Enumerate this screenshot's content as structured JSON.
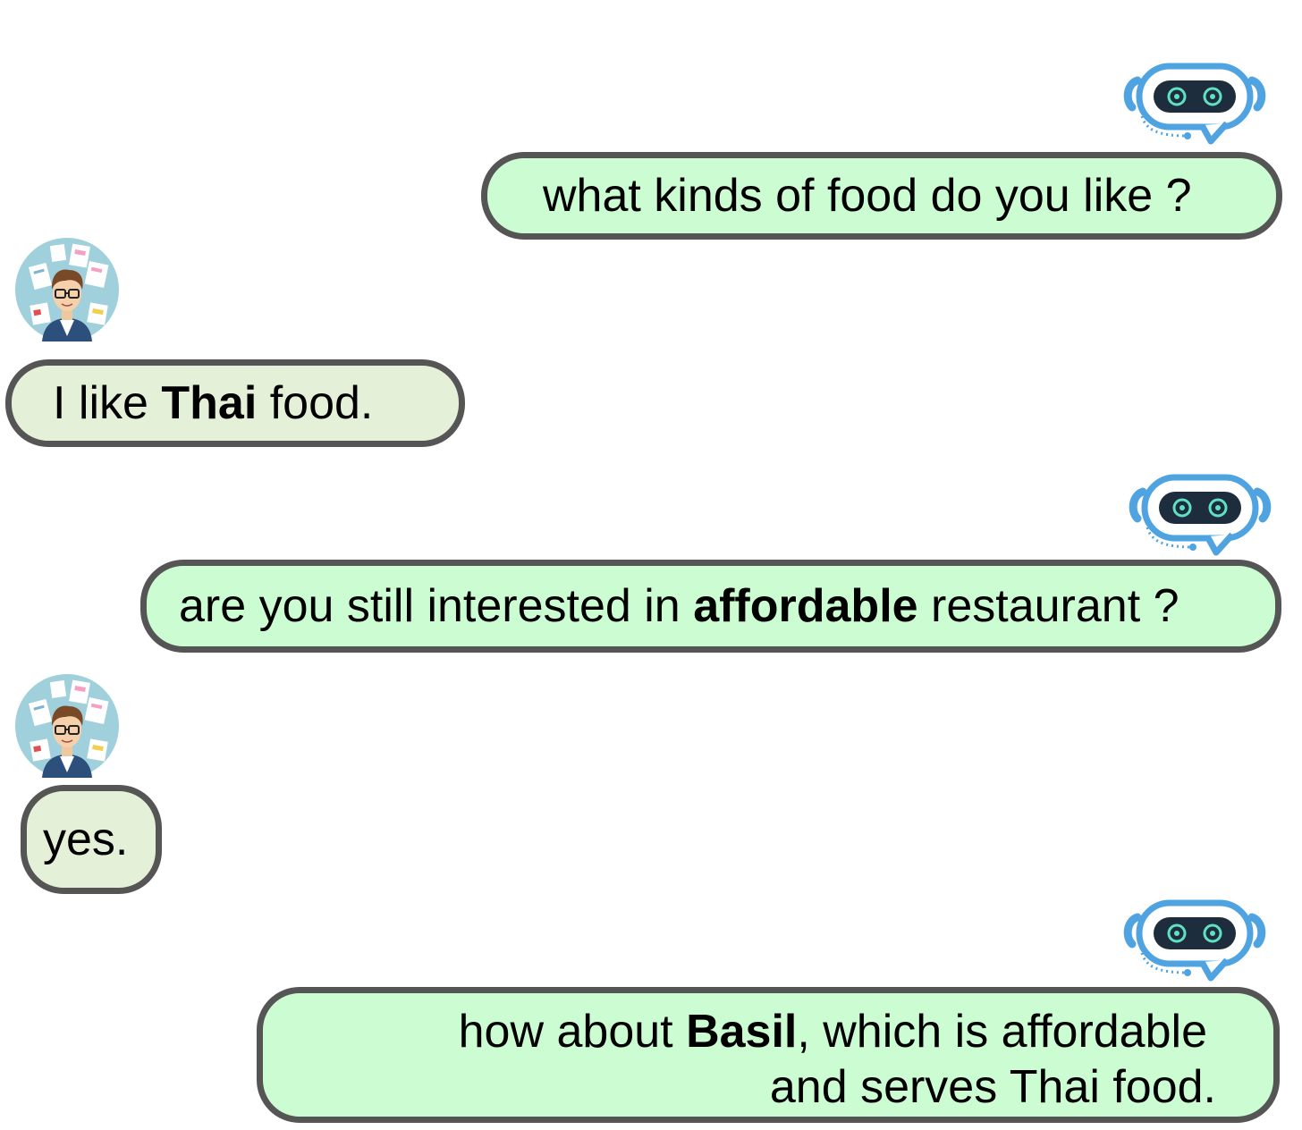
{
  "messages": [
    {
      "speaker": "bot",
      "parts": [
        {
          "t": "what kinds of food do you like ?"
        }
      ]
    },
    {
      "speaker": "user",
      "parts": [
        {
          "t": "I like "
        },
        {
          "t": "Thai",
          "bold": true
        },
        {
          "t": " food."
        }
      ]
    },
    {
      "speaker": "bot",
      "parts": [
        {
          "t": "are you still interested in "
        },
        {
          "t": "affordable",
          "bold": true
        },
        {
          "t": " restaurant ?"
        }
      ]
    },
    {
      "speaker": "user",
      "parts": [
        {
          "t": "yes."
        }
      ]
    },
    {
      "speaker": "bot",
      "parts": [
        {
          "t": "how about "
        },
        {
          "t": "Basil",
          "bold": true
        },
        {
          "t": ", which is affordable"
        },
        {
          "t": "and serves Thai food."
        }
      ]
    }
  ],
  "colors": {
    "bot_bubble": "#ccfdd2",
    "user_bubble": "#e5f0d8",
    "bubble_border": "#555555",
    "robot_accent": "#4fa3e0",
    "robot_visor": "#1e2d3d",
    "robot_eyes": "#5fe0c0"
  },
  "icons": {
    "bot_avatar": "robot-chat-icon",
    "user_avatar": "user-avatar-icon"
  }
}
